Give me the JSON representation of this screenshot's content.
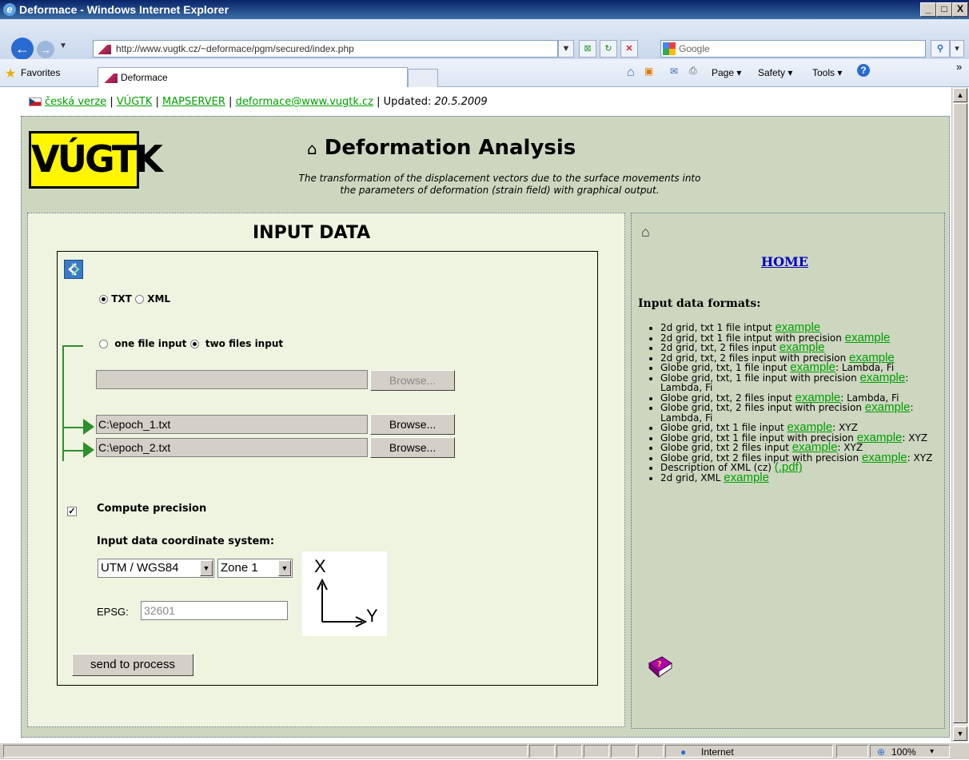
{
  "window": {
    "title": "Deformace - Windows Internet Explorer",
    "minimize": "_",
    "maximize": "□",
    "close": "X"
  },
  "browser": {
    "address": "http://www.vugtk.cz/~deformace/pgm/secured/index.php",
    "search_placeholder": "Google",
    "favorites_label": "Favorites",
    "tab_title": "Deformace",
    "page_menu": "Page ▾",
    "safety_menu": "Safety ▾",
    "tools_menu": "Tools ▾",
    "chevron": "»"
  },
  "topbar": {
    "czech_version": "česká verze",
    "vugtk": "VÚGTK",
    "mapserver": "MAPSERVER",
    "email": "deformace@www.vugtk.cz",
    "separator": "|",
    "updated_label": "Updated:",
    "updated_date": "20.5.2009"
  },
  "header": {
    "logo_text": "VÚGTK",
    "title": "Deformation Analysis",
    "subtitle_line1": "The transformation of the displacement vectors due to the surface movements into",
    "subtitle_line2": "the parameters of deformation (strain field) with graphical output."
  },
  "form": {
    "heading": "INPUT DATA",
    "format_txt": "TXT",
    "format_xml": "XML",
    "selected_format": "TXT",
    "one_file": "one file input",
    "two_files": "two files input",
    "selected_input_mode": "two files input",
    "single_file_value": "",
    "epoch1_value": "C:\\epoch_1.txt",
    "epoch2_value": "C:\\epoch_2.txt",
    "browse_label": "Browse...",
    "compute_precision_label": "Compute precision",
    "compute_precision_checked": true,
    "coord_system_label": "Input data coordinate system:",
    "projection_value": "UTM / WGS84",
    "zone_value": "Zone 1",
    "epsg_label": "EPSG:",
    "epsg_value": "32601",
    "axis_x": "X",
    "axis_y": "Y",
    "submit_label": "send to process"
  },
  "sidebar": {
    "home_label": "HOME",
    "formats_heading": "Input data formats:",
    "formats": [
      {
        "pre": "2d grid, txt 1 file intput ",
        "link": "example",
        "post": ""
      },
      {
        "pre": "2d grid, txt 1 file intput with precision ",
        "link": "example",
        "post": ""
      },
      {
        "pre": "2d grid, txt, 2 files input ",
        "link": "example",
        "post": ""
      },
      {
        "pre": "2d grid, txt, 2 files input with precision ",
        "link": "example",
        "post": ""
      },
      {
        "pre": "Globe grid, txt, 1 file input ",
        "link": "example",
        "post": ": Lambda, Fi"
      },
      {
        "pre": "Globe grid, txt, 1 file input with precision ",
        "link": "example",
        "post": ": Lambda, Fi"
      },
      {
        "pre": "Globe grid, txt, 2 files input ",
        "link": "example",
        "post": ": Lambda, Fi"
      },
      {
        "pre": "Globe grid, txt, 2 files input with precision ",
        "link": "example",
        "post": ": Lambda, Fi"
      },
      {
        "pre": "Globe grid, txt 1 file input ",
        "link": "example",
        "post": ": XYZ"
      },
      {
        "pre": "Globe grid, txt 1 file input with precision ",
        "link": "example",
        "post": ": XYZ"
      },
      {
        "pre": "Globe grid, txt 2 files input ",
        "link": "example",
        "post": ": XYZ"
      },
      {
        "pre": "Globe grid, txt 2 files input with precision ",
        "link": "example",
        "post": ": XYZ"
      },
      {
        "pre": "Description of XML (cz) ",
        "link": "(.pdf)",
        "post": ""
      },
      {
        "pre": "2d grid, XML ",
        "link": "example",
        "post": ""
      }
    ]
  },
  "status": {
    "zone": "Internet",
    "zoom": "100%"
  }
}
